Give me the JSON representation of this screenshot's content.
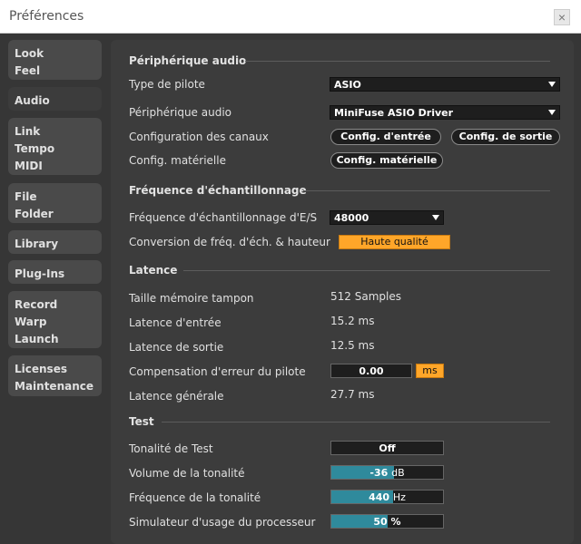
{
  "window": {
    "title": "Préférences",
    "close_glyph": "×"
  },
  "sidebar": {
    "tabs": [
      {
        "lines": [
          "Look",
          "Feel"
        ]
      },
      {
        "lines": [
          "Audio"
        ]
      },
      {
        "lines": [
          "Link",
          "Tempo",
          "MIDI"
        ]
      },
      {
        "lines": [
          "File",
          "Folder"
        ]
      },
      {
        "lines": [
          "Library"
        ]
      },
      {
        "lines": [
          "Plug-Ins"
        ]
      },
      {
        "lines": [
          "Record",
          "Warp",
          "Launch"
        ]
      },
      {
        "lines": [
          "Licenses",
          "Maintenance"
        ]
      }
    ],
    "active": "Audio"
  },
  "sections": {
    "device": {
      "title": "Périphérique audio",
      "driver_type_label": "Type de pilote",
      "driver_type_value": "ASIO",
      "device_label": "Périphérique audio",
      "device_value": "MiniFuse ASIO Driver",
      "channels_label": "Configuration des canaux",
      "input_config": "Config. d'entrée",
      "output_config": "Config. de sortie",
      "hardware_label": "Config. matérielle",
      "hardware_button": "Config. matérielle"
    },
    "sample_rate": {
      "title": "Fréquence d'échantillonnage",
      "io_rate_label": "Fréquence d'échantillonnage d'E/S",
      "io_rate_value": "48000",
      "conversion_label": "Conversion de fréq. d'éch. & hauteur",
      "conversion_value": "Haute qualité"
    },
    "latency": {
      "title": "Latence",
      "buffer_label": "Taille mémoire tampon",
      "buffer_value": "512 Samples",
      "input_label": "Latence d'entrée",
      "input_value": "15.2 ms",
      "output_label": "Latence de sortie",
      "output_value": "12.5 ms",
      "compensation_label": "Compensation d'erreur du pilote",
      "compensation_value": "0.00",
      "compensation_unit": "ms",
      "overall_label": "Latence générale",
      "overall_value": "27.7 ms"
    },
    "test": {
      "title": "Test",
      "tone_label": "Tonalité de Test",
      "tone_value": "Off",
      "volume_label": "Volume de la tonalité",
      "volume_value": "-36",
      "volume_unit": "dB",
      "volume_level": 0.56,
      "frequency_label": "Fréquence de la tonalité",
      "frequency_value": "440",
      "frequency_unit": "Hz",
      "frequency_level": 0.55,
      "cpu_label": "Simulateur d'usage du processeur",
      "cpu_value": "50 %",
      "cpu_level": 0.5
    }
  },
  "colors": {
    "accent": "#ffa629",
    "meter": "#2f8a9c",
    "panel": "#3c3c3c"
  }
}
